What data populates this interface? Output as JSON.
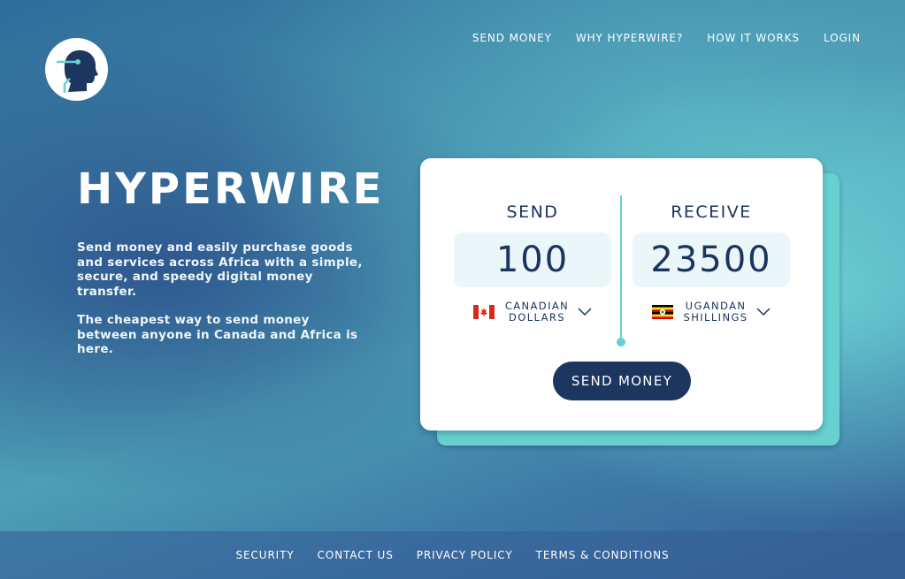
{
  "nav": {
    "items": [
      "SEND MONEY",
      "WHY HYPERWIRE?",
      "HOW IT WORKS",
      "LOGIN"
    ]
  },
  "hero": {
    "title": "HYPERWIRE",
    "paragraph1": "Send money and easily purchase goods and services across Africa with a simple, secure, and speedy digital money transfer.",
    "paragraph2": "The cheapest way to send money between anyone in Canada and Africa is here."
  },
  "converter": {
    "send": {
      "label": "SEND",
      "amount": "100",
      "currency_line1": "CANADIAN",
      "currency_line2": "DOLLARS",
      "flag": "canada-flag-icon"
    },
    "receive": {
      "label": "RECEIVE",
      "amount": "23500",
      "currency_line1": "UGANDAN",
      "currency_line2": "SHILLINGS",
      "flag": "uganda-flag-icon"
    },
    "button_label": "SEND MONEY"
  },
  "footer": {
    "links": [
      "SECURITY",
      "CONTACT US",
      "PRIVACY POLICY",
      "TERMS & CONDITIONS"
    ]
  },
  "colors": {
    "navy": "#1c3660",
    "teal": "#67d1d0",
    "input_bg": "#eaf6f8"
  }
}
